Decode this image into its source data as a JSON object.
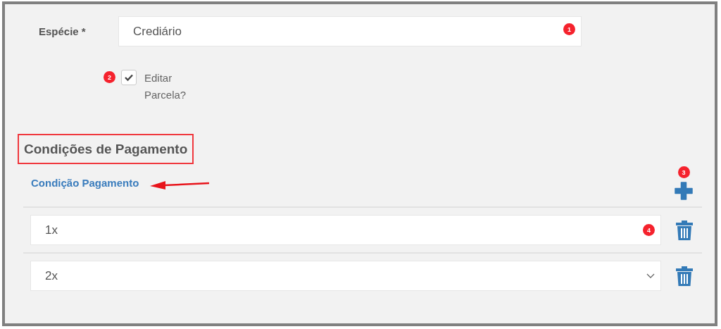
{
  "especie": {
    "label": "Espécie *",
    "value": "Crediário",
    "badge": "1"
  },
  "edit_parcela": {
    "label": "Editar Parcela?",
    "checked": true,
    "badge": "2"
  },
  "section": {
    "title": "Condições de Pagamento",
    "highlighted": true
  },
  "conditions": {
    "header": "Condição Pagamento",
    "add_badge": "3",
    "rows": [
      {
        "value": "1x",
        "badge": "4"
      },
      {
        "value": "2x"
      }
    ]
  }
}
